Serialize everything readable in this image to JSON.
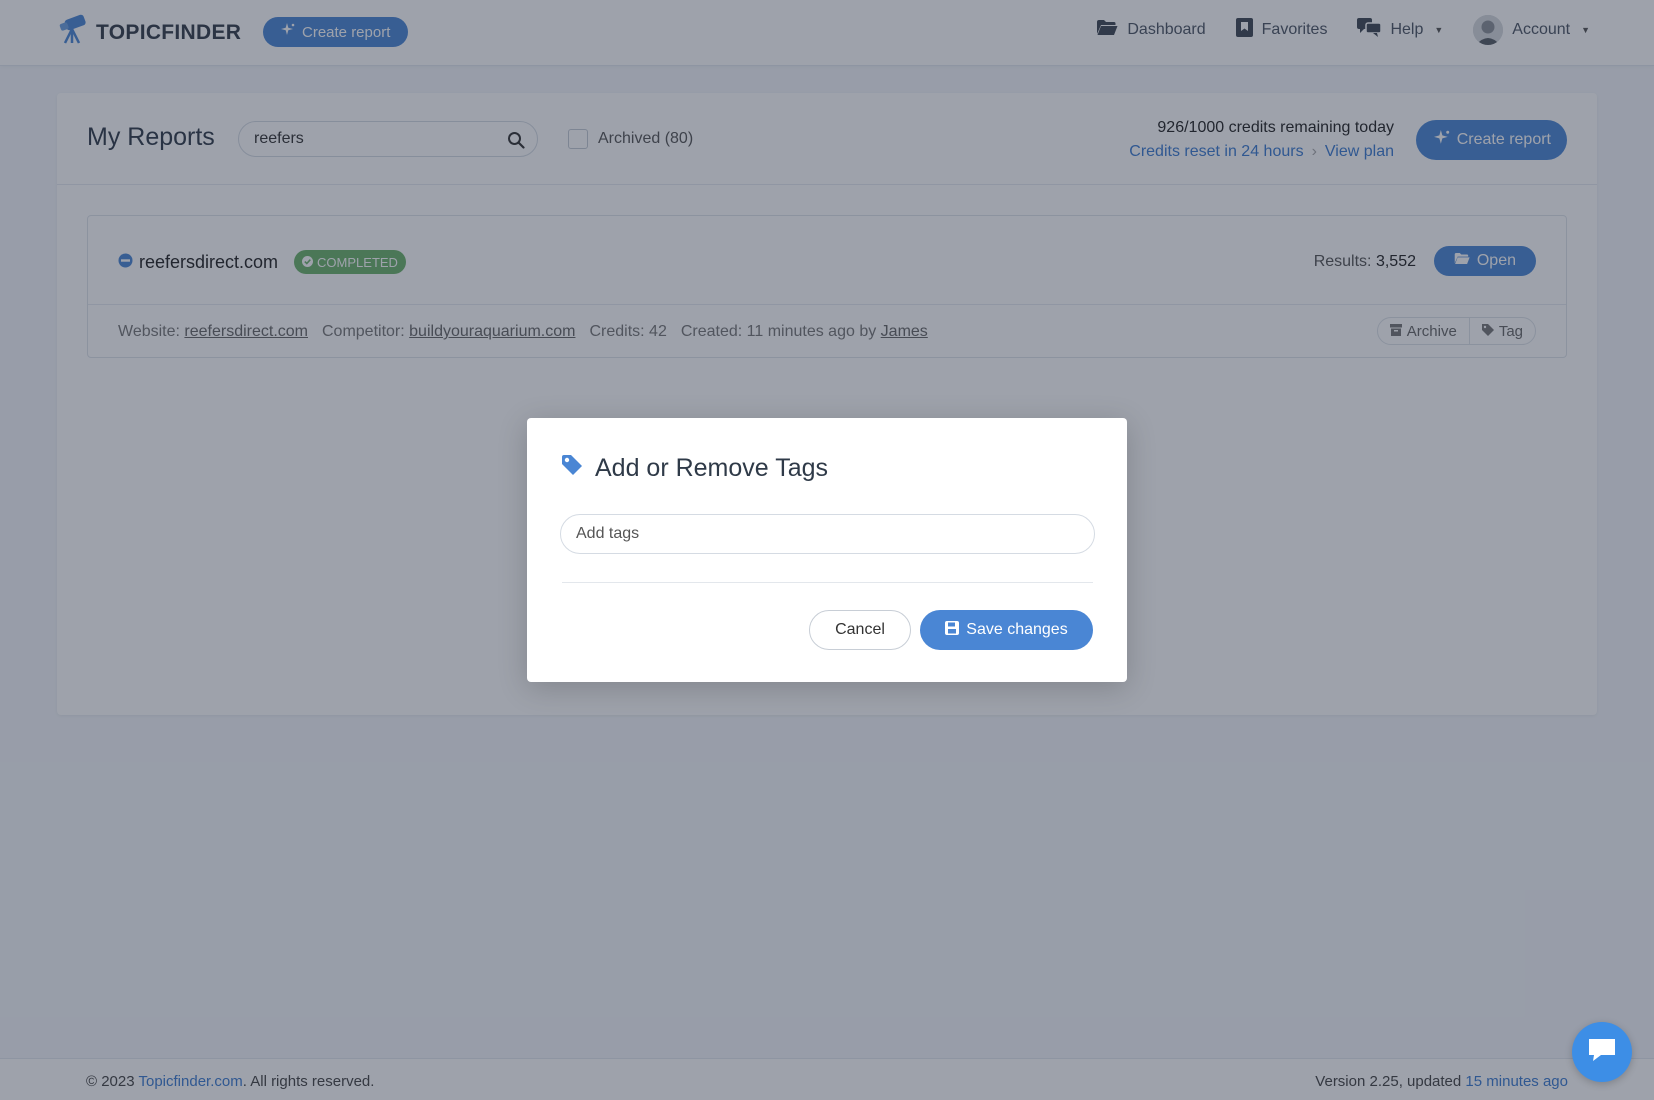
{
  "nav": {
    "brand": "TOPICFINDER",
    "create_report": "Create report",
    "links": {
      "dashboard": "Dashboard",
      "favorites": "Favorites",
      "help": "Help",
      "account": "Account"
    }
  },
  "reports": {
    "title": "My Reports",
    "search_value": "reefers",
    "archived_label": "Archived (80)",
    "credits_remaining": "926/1000 credits remaining today",
    "credits_reset": "Credits reset in 24 hours",
    "view_plan": "View plan",
    "create_report": "Create report",
    "items": [
      {
        "name": "reefersdirect.com",
        "status": "COMPLETED",
        "results_label": "Results:",
        "results_value": "3,552",
        "open_label": "Open",
        "website_label": "Website:",
        "website": "reefersdirect.com",
        "competitor_label": "Competitor:",
        "competitor": "buildyouraquarium.com",
        "credits": "Credits: 42",
        "created": "Created: 11 minutes ago by",
        "created_by": "James",
        "archive_label": "Archive",
        "tag_label": "Tag"
      }
    ]
  },
  "modal": {
    "title": "Add or Remove Tags",
    "tags_placeholder": "Add tags",
    "cancel": "Cancel",
    "save": "Save changes"
  },
  "footer": {
    "copyright_prefix": "© 2023 ",
    "site_link": "Topicfinder.com",
    "copyright_suffix": ". All rights reserved.",
    "version_prefix": "Version 2.25, updated ",
    "updated": "15 minutes ago"
  },
  "colors": {
    "accent": "#4a86d4",
    "success": "#6bb36a",
    "chat": "#3d8ee6"
  },
  "icons": [
    "telescope-icon",
    "sparkle-icon",
    "folder-icon",
    "bookmark-icon",
    "chat-icon",
    "search-icon",
    "tag-icon",
    "archive-icon",
    "save-icon",
    "check-circle-icon",
    "globe-icon"
  ]
}
